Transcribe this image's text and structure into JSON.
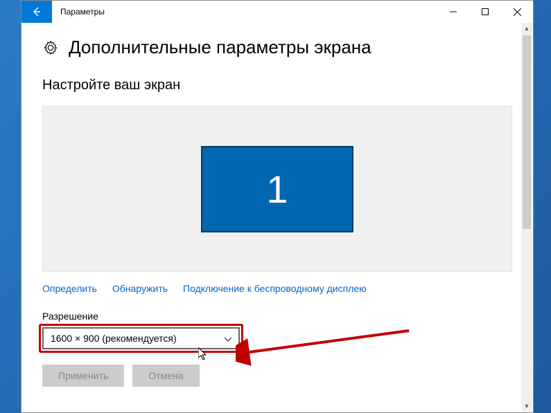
{
  "window": {
    "title": "Параметры"
  },
  "page": {
    "title": "Дополнительные параметры экрана",
    "section_title": "Настройте ваш экран",
    "monitor_number": "1"
  },
  "links": {
    "detect": "Определить",
    "discover": "Обнаружить",
    "wireless": "Подключение к беспроводному дисплею"
  },
  "resolution": {
    "label": "Разрешение",
    "value": "1600 × 900 (рекомендуется)"
  },
  "buttons": {
    "apply": "Применить",
    "cancel": "Отмена"
  }
}
